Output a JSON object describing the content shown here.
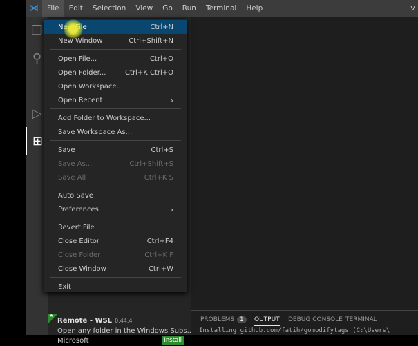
{
  "menubar": {
    "items": [
      "File",
      "Edit",
      "Selection",
      "View",
      "Go",
      "Run",
      "Terminal",
      "Help"
    ],
    "title": "V"
  },
  "file_menu": [
    {
      "label": "New File",
      "key": "Ctrl+N",
      "state": "highlighted"
    },
    {
      "label": "New Window",
      "key": "Ctrl+Shift+N"
    },
    {
      "sep": true
    },
    {
      "label": "Open File...",
      "key": "Ctrl+O"
    },
    {
      "label": "Open Folder...",
      "key": "Ctrl+K Ctrl+O"
    },
    {
      "label": "Open Workspace...",
      "key": ""
    },
    {
      "label": "Open Recent",
      "key": "",
      "submenu": true
    },
    {
      "sep": true
    },
    {
      "label": "Add Folder to Workspace...",
      "key": ""
    },
    {
      "label": "Save Workspace As...",
      "key": ""
    },
    {
      "sep": true
    },
    {
      "label": "Save",
      "key": "Ctrl+S"
    },
    {
      "label": "Save As...",
      "key": "Ctrl+Shift+S",
      "disabled": true
    },
    {
      "label": "Save All",
      "key": "Ctrl+K S",
      "disabled": true
    },
    {
      "sep": true
    },
    {
      "label": "Auto Save",
      "key": ""
    },
    {
      "label": "Preferences",
      "key": "",
      "submenu": true
    },
    {
      "sep": true
    },
    {
      "label": "Revert File",
      "key": ""
    },
    {
      "label": "Close Editor",
      "key": "Ctrl+F4"
    },
    {
      "label": "Close Folder",
      "key": "Ctrl+K F",
      "disabled": true
    },
    {
      "label": "Close Window",
      "key": "Ctrl+W"
    },
    {
      "sep": true
    },
    {
      "label": "Exit",
      "key": ""
    }
  ],
  "extension": {
    "name": "Remote - WSL",
    "version": "0.44.4",
    "description": "Open any folder in the Windows Subs...",
    "publisher": "Microsoft",
    "install_label": "Install"
  },
  "panel": {
    "tabs": [
      "PROBLEMS",
      "OUTPUT",
      "DEBUG CONSOLE",
      "TERMINAL"
    ],
    "problems_count": "1",
    "active": "OUTPUT",
    "output_text": "Installing github.com/fatih/gomodifytags (C:\\Users\\"
  }
}
